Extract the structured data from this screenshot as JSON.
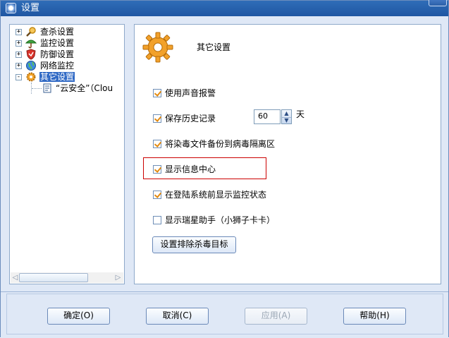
{
  "window": {
    "title": "设置"
  },
  "tree": {
    "items": [
      {
        "label": "查杀设置",
        "icon": "magnifier-icon",
        "expander": "+"
      },
      {
        "label": "监控设置",
        "icon": "umbrella-icon",
        "expander": "+"
      },
      {
        "label": "防御设置",
        "icon": "shield-icon",
        "expander": "+"
      },
      {
        "label": "网络监控",
        "icon": "globe-icon",
        "expander": "+"
      },
      {
        "label": "其它设置",
        "icon": "gear-icon",
        "expander": "-",
        "selected": true
      }
    ],
    "child": {
      "label": "“云安全”（Clou",
      "icon": "document-icon"
    },
    "scroll_left": "◁",
    "scroll_right": "▷"
  },
  "panel": {
    "title": "其它设置",
    "options": [
      {
        "label": "使用声音报警",
        "checked": true
      },
      {
        "label": "保存历史记录",
        "checked": true
      },
      {
        "label": "将染毒文件备份到病毒隔离区",
        "checked": true
      },
      {
        "label": "显示信息中心",
        "checked": true
      },
      {
        "label": "在登陆系统前显示监控状态",
        "checked": true
      },
      {
        "label": "显示瑞星助手（小狮子卡卡）",
        "checked": false
      }
    ],
    "history_days": "60",
    "history_unit": "天",
    "spin_up": "▲",
    "spin_down": "▼",
    "exclude_button": "设置排除杀毒目标"
  },
  "buttons": {
    "ok": "确定(O)",
    "cancel": "取消(C)",
    "apply": "应用(A)",
    "help": "帮助(H)"
  },
  "colors": {
    "title_bar": "#1f57a3",
    "selection": "#316ac5",
    "highlight_border": "#cc0000",
    "checkmark": "#e28a11"
  }
}
